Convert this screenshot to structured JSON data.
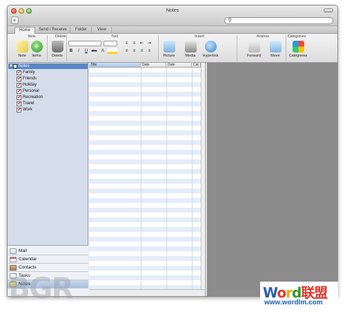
{
  "window": {
    "title": "Notes"
  },
  "tabs": [
    "Home",
    "Send / Receive",
    "Folder",
    "View"
  ],
  "ribbon": {
    "groups": [
      "New",
      "Delete",
      "Text",
      "Insert",
      "Actions",
      "Categories"
    ],
    "buttons": {
      "note": "Note",
      "items": "Items",
      "delete": "Delete",
      "picture": "Picture",
      "media": "Media",
      "hyperlink": "Hyperlink",
      "forward": "Forward",
      "move": "Move",
      "categories": "Categories"
    },
    "format": {
      "bold": "B",
      "italic": "I",
      "underline": "U",
      "strike": "abc",
      "font_size_a": "A"
    }
  },
  "sidebar": {
    "root": "Notes",
    "items": [
      "Family",
      "Friends",
      "Holiday",
      "Personal",
      "Recreation",
      "Travel",
      "Work"
    ],
    "nav": [
      "Mail",
      "Calendar",
      "Contacts",
      "Tasks",
      "Notes"
    ],
    "active_nav": "Notes"
  },
  "list": {
    "columns": [
      "Title",
      "Date",
      "Date",
      "Cat"
    ],
    "sorted_column": "Title"
  },
  "watermarks": {
    "bgr": "BGR",
    "site_title": "Word联盟",
    "site_url": "www.wordlm.com"
  },
  "colors": {
    "sidebar_bg": "#d4dde9",
    "selection": "#5a86c6",
    "reading_pane": "#8c8c8c",
    "row_stripe": "#e4edf9"
  }
}
